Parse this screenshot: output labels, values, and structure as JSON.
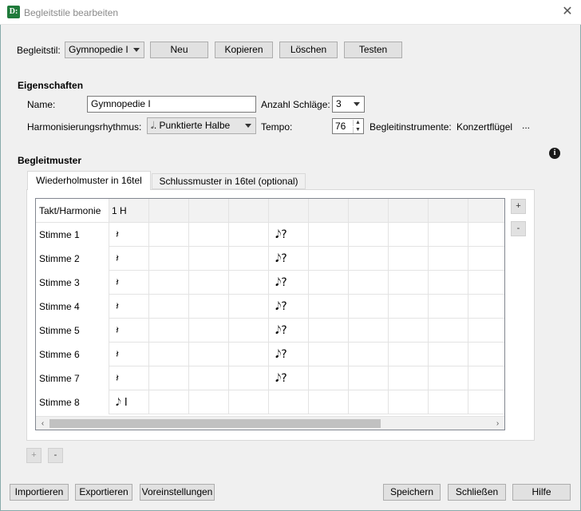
{
  "window": {
    "title": "Begleitstile bearbeiten",
    "app_icon": "D:",
    "close": "✕"
  },
  "top": {
    "style_label": "Begleitstil:",
    "style_value": "Gymnopedie I",
    "new_label": "Neu",
    "copy_label": "Kopieren",
    "delete_label": "Löschen",
    "test_label": "Testen"
  },
  "props": {
    "section_title": "Eigenschaften",
    "name_label": "Name:",
    "name_value": "Gymnopedie I",
    "beats_label": "Anzahl Schläge:",
    "beats_value": "3",
    "harm_label": "Harmonisierungsrhythmus:",
    "harm_value": "𝅗𝅥. Punktierte Halbe",
    "tempo_label": "Tempo:",
    "tempo_value": "76",
    "instr_label": "Begleitinstrumente:",
    "instr_value": "Konzertflügel",
    "instr_more": "..."
  },
  "pattern": {
    "section_title": "Begleitmuster",
    "info_icon": "i",
    "tabs": [
      {
        "label": "Wiederholmuster in 16tel"
      },
      {
        "label": "Schlussmuster in 16tel (optional)"
      }
    ],
    "corner_header": "Takt/Harmonie",
    "first_col_header": "1 H",
    "rows": [
      {
        "label": "Stimme 1",
        "c0": "𝄽",
        "c4": "𝅘𝅥𝅮?"
      },
      {
        "label": "Stimme 2",
        "c0": "𝄽",
        "c4": "𝅘𝅥𝅮?"
      },
      {
        "label": "Stimme 3",
        "c0": "𝄽",
        "c4": "𝅘𝅥𝅮?"
      },
      {
        "label": "Stimme 4",
        "c0": "𝄽",
        "c4": "𝅘𝅥𝅮?"
      },
      {
        "label": "Stimme 5",
        "c0": "𝄽",
        "c4": "𝅘𝅥𝅮?"
      },
      {
        "label": "Stimme 6",
        "c0": "𝄽",
        "c4": "𝅘𝅥𝅮?"
      },
      {
        "label": "Stimme 7",
        "c0": "𝄽",
        "c4": "𝅘𝅥𝅮?"
      },
      {
        "label": "Stimme 8",
        "c0": "𝅘𝅥𝅮 I",
        "c4": ""
      }
    ],
    "col_add": "+",
    "col_remove": "-",
    "row_add": "+",
    "row_remove": "-"
  },
  "bottom": {
    "import_label": "Importieren",
    "export_label": "Exportieren",
    "prefs_label": "Voreinstellungen",
    "save_label": "Speichern",
    "close_label": "Schließen",
    "help_label": "Hilfe"
  }
}
